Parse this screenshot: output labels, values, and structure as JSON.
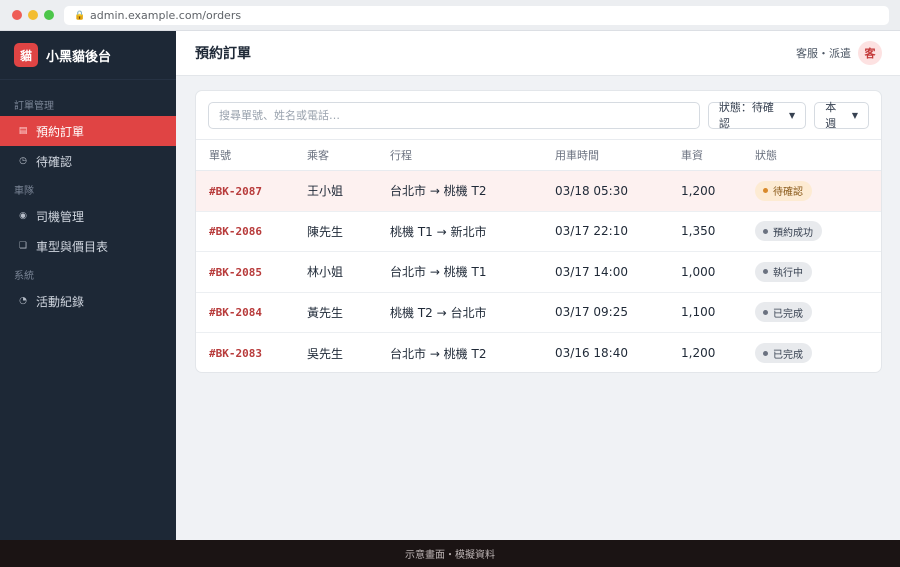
{
  "browser": {
    "url": "admin.example.com/orders"
  },
  "brand": {
    "logo_char": "貓",
    "name": "小黑貓後台"
  },
  "sidebar": {
    "sections": [
      {
        "label": "訂單管理",
        "items": [
          {
            "label": "預約訂單",
            "active": true
          },
          {
            "label": "待確認"
          }
        ]
      },
      {
        "label": "車隊",
        "items": [
          {
            "label": "司機管理"
          },
          {
            "label": "車型與價目表"
          }
        ]
      },
      {
        "label": "系統",
        "items": [
          {
            "label": "活動紀錄"
          }
        ]
      }
    ]
  },
  "header": {
    "title": "預約訂單",
    "role": "客服・派遣",
    "avatar_char": "客"
  },
  "toolbar": {
    "search_placeholder": "搜尋單號、姓名或電話…",
    "status_filter": "狀態：待確認",
    "period_filter": "本週"
  },
  "table": {
    "columns": [
      "單號",
      "乘客",
      "行程",
      "用車時間",
      "車資",
      "狀態"
    ],
    "rows": [
      {
        "id": "#BK-2087",
        "passenger": "王小姐",
        "route": "台北市 → 桃機 T2",
        "time": "03/18 05:30",
        "fare": "1,200",
        "status": "待確認"
      },
      {
        "id": "#BK-2086",
        "passenger": "陳先生",
        "route": "桃機 T1 → 新北市",
        "time": "03/17 22:10",
        "fare": "1,350",
        "status": "預約成功"
      },
      {
        "id": "#BK-2085",
        "passenger": "林小姐",
        "route": "台北市 → 桃機 T1",
        "time": "03/17 14:00",
        "fare": "1,000",
        "status": "執行中"
      },
      {
        "id": "#BK-2084",
        "passenger": "黃先生",
        "route": "桃機 T2 → 台北市",
        "time": "03/17 09:25",
        "fare": "1,100",
        "status": "已完成"
      },
      {
        "id": "#BK-2083",
        "passenger": "吳先生",
        "route": "台北市 → 桃機 T2",
        "time": "03/16 18:40",
        "fare": "1,200",
        "status": "已完成"
      }
    ]
  },
  "footer": {
    "text": "示意畫面・模擬資料"
  },
  "colors": {
    "accent": "#e04444",
    "sidebar_bg": "#1d2836",
    "highlight_row": "#fdf1f0",
    "pending_badge": "#fdebd3"
  }
}
